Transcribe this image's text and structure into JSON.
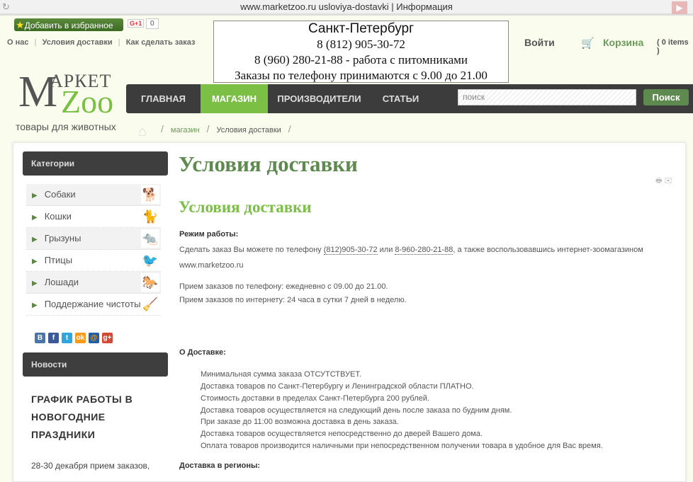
{
  "browser": {
    "title": "www.marketzoo.ru  usloviya-dostavki | Информация"
  },
  "top": {
    "favorite": "Добавить в избранное",
    "gplus": "G+1",
    "gcount": "0",
    "links": [
      "О нас",
      "Условия доставки",
      "Как сделать заказ"
    ]
  },
  "contact": {
    "city": "Санкт-Петербург",
    "phone1": "8 (812) 905-30-72",
    "phone2": "8 (960) 280-21-88 - работа с питомниками",
    "hours": "Заказы по телефону принимаются с 9.00 до 21.00"
  },
  "account": {
    "login": "Войти",
    "cart": "Корзина",
    "items": "( 0 items )"
  },
  "logo": {
    "m": "M",
    "arket": "АРКЕТ",
    "zoo": "Zoo",
    "tagline": "товары для животных"
  },
  "nav": {
    "items": [
      "ГЛАВНАЯ",
      "МАГАЗИН",
      "ПРОИЗВОДИТЕЛИ",
      "СТАТЬИ"
    ],
    "active": 1,
    "search_placeholder": "поиск",
    "search_button": "Поиск"
  },
  "breadcrumb": [
    "магазин",
    "Условия доставки"
  ],
  "sidebar": {
    "categories_title": "Категории",
    "categories": [
      "Собаки",
      "Кошки",
      "Грызуны",
      "Птицы",
      "Лошади",
      "Поддержание чистоты"
    ],
    "social": [
      "В",
      "f",
      "t",
      "ok",
      "@",
      "g+"
    ],
    "news_title": "Новости",
    "news_headline": "ГРАФИК РАБОТЫ В НОВОГОДНИЕ ПРАЗДНИКИ",
    "news_text": "28-30 декабря  прием заказов,"
  },
  "content": {
    "title": "Условия доставки",
    "subtitle": "Условия доставки",
    "mode_heading": "Режим работы:",
    "mode_pre": "Сделать заказ Вы можете по телефону ",
    "phone_a": "(812)905-30-72",
    "mode_mid": " или ",
    "phone_b": "8-960-280-21-88",
    "mode_post": ", а также воспользовавшись интернет-зоомагазином",
    "site": "www.marketzoo.ru",
    "phone_hours": "Прием заказов по телефону: ежедневно с 09.00 до 21.00.",
    "web_hours": "Прием заказов по интернету: 24 часа в сутки 7 дней в неделю.",
    "delivery_heading": "О Доставке:",
    "delivery": [
      "Минимальная сумма заказа ОТСУТСТВУЕТ.",
      "Доставка товаров по Санкт-Петербургу и Ленинградской области ПЛАТНО.",
      "Стоимость доставки в пределах Санкт-Петербурга 200 рублей.",
      "Доставка товаров осуществляется на следующий день после заказа по будним дням.",
      "При заказе до 11:00 возможна доставка в день заказа.",
      "Доставка товаров осуществляется непосредственно до дверей Вашего дома.",
      "Оплата товаров производится наличными при непосредственном получении товара в удобное для Вас время."
    ],
    "regions_heading": "Доставка в регионы:"
  }
}
